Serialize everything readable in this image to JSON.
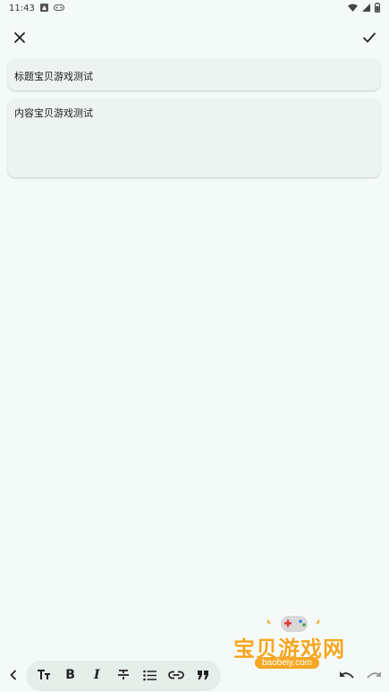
{
  "status_bar": {
    "time": "11:43"
  },
  "editor": {
    "title_value": "标题宝贝游戏测试",
    "content_value": "内容宝贝游戏测试"
  },
  "toolbar": {
    "bold_label": "B",
    "italic_label": "I"
  },
  "watermark": {
    "text": "宝贝游戏网",
    "url": "baobeiy.com"
  },
  "colors": {
    "background": "#f3faf7",
    "field": "#edf3f0",
    "watermark": "#f5a623"
  },
  "icons": [
    "close-icon",
    "check-icon",
    "chevron-left-icon",
    "text-size-icon",
    "bold-icon",
    "italic-icon",
    "strikethrough-icon",
    "list-icon",
    "link-icon",
    "quote-icon",
    "undo-icon",
    "redo-icon"
  ]
}
